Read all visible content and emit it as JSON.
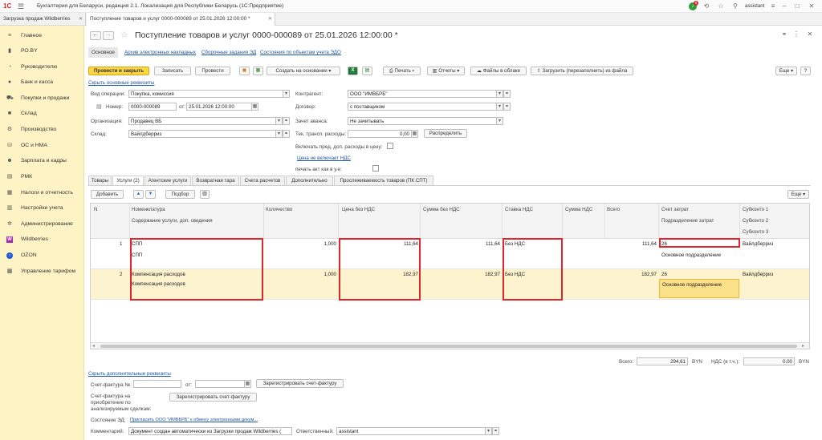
{
  "window": {
    "logo": "1С",
    "title": "Бухгалтерия для Беларуси, редакция 2.1. Локализация для Республики Беларусь   (1С:Предприятие)",
    "notification_count": "6",
    "user": "assistant"
  },
  "app_tabs": [
    {
      "label": "Загрузка продаж Wildberries"
    },
    {
      "label": "Поступление товаров и услуг 0000-000089 от 25.01.2026 12:00:00 *"
    }
  ],
  "sidebar": {
    "items": [
      {
        "label": "Главное",
        "icon": "menu-icon"
      },
      {
        "label": "РО.BY",
        "icon": "chart-icon"
      },
      {
        "label": "Руководителю",
        "icon": "chart-icon"
      },
      {
        "label": "Банк и касса",
        "icon": "coins-icon"
      },
      {
        "label": "Покупки и продажи",
        "icon": "cart-icon"
      },
      {
        "label": "Склад",
        "icon": "box-icon"
      },
      {
        "label": "Производство",
        "icon": "factory-icon"
      },
      {
        "label": "ОС и НМА",
        "icon": "asset-icon"
      },
      {
        "label": "Зарплата и кадры",
        "icon": "people-icon"
      },
      {
        "label": "РМК",
        "icon": "register-icon"
      },
      {
        "label": "Налоги и отчетность",
        "icon": "tax-icon"
      },
      {
        "label": "Настройки учета",
        "icon": "settings-icon"
      },
      {
        "label": "Администрирование",
        "icon": "gear-icon"
      },
      {
        "label": "Wildberries",
        "icon": "wb-icon",
        "badge": "W"
      },
      {
        "label": "OZON",
        "icon": "ozon-icon"
      },
      {
        "label": "Управление тарифом",
        "icon": "tariff-icon"
      }
    ]
  },
  "document": {
    "title": "Поступление товаров и услуг 0000-000089 от 25.01.2026 12:00:00 *",
    "subtabs": [
      "Основное",
      "Архив электронных накладных",
      "Сборочные задания ЭД",
      "Состояния по объектам учета ЭДО"
    ]
  },
  "toolbar": {
    "post_close": "Провести и закрыть",
    "save": "Записать",
    "post": "Провести",
    "create_based": "Создать на основании",
    "print": "Печать",
    "reports": "Отчеты",
    "cloud_files": "Файлы в облаке",
    "load_from_file": "Загрузить (перезаполнить) из файла",
    "more": "Еще",
    "help": "?"
  },
  "form": {
    "hide_main": "Скрыть основные реквизиты",
    "operation_label": "Вид операции:",
    "operation_value": "Покупка, комиссия",
    "number_label": "Номер:",
    "number_value": "0000-000089",
    "date_label": "от:",
    "date_value": "25.01.2026 12:00:00",
    "org_label": "Организация:",
    "org_value": "Продавец ВБ",
    "warehouse_label": "Склад:",
    "warehouse_value": "Вайлдберриз",
    "contractor_label": "Контрагент:",
    "contractor_value": "ООО \"ИМВБРБ\"",
    "contract_label": "Договор:",
    "contract_value": "с поставщиком",
    "advance_label": "Зачет аванса:",
    "advance_value": "Не зачитывать",
    "transport_label": "Тек. трансп. расходы:",
    "transport_value": "0,00",
    "distribute": "Распределить",
    "include_costs": "Включать пред. доп. расходы в цену:",
    "price_no_vat": "Цена не включает НДС",
    "print_act": "печать акт как в у.е:"
  },
  "doc_tabs": [
    "Товары",
    "Услуги (2)",
    "Агентские услуги",
    "Возвратная тара",
    "Счета расчетов",
    "Дополнительно",
    "Прослеживаемость товаров (ПК СПТ)"
  ],
  "grid_toolbar": {
    "add": "Добавить",
    "pick": "Подбор",
    "more": "Еще"
  },
  "grid": {
    "headers": {
      "n": "N",
      "item": "Номенклатура",
      "item_sub": "Содержание услуги, доп. сведения",
      "qty": "Количество",
      "price": "Цена без НДС",
      "sum": "Сумма без НДС",
      "vat_rate": "Ставка НДС",
      "vat_sum": "Сумма НДС",
      "total": "Всего",
      "account": "Счет затрат",
      "division": "Подразделение затрат",
      "sub1": "Субконто 1",
      "sub2": "Субконто 2",
      "sub3": "Субконто 3"
    },
    "rows": [
      {
        "n": "1",
        "item": "СПП",
        "content": "СПП",
        "qty": "1,000",
        "price": "111,64",
        "sum": "111,64",
        "vat_rate": "Без НДС",
        "total": "111,64",
        "account": "26",
        "division": "Основное подразделение",
        "sub1": "Вайлдберриз"
      },
      {
        "n": "2",
        "item": "Компенсация расходов",
        "content": "Компенсация расходов",
        "qty": "1,000",
        "price": "182,97",
        "sum": "182,97",
        "vat_rate": "Без НДС",
        "total": "182,97",
        "account": "26",
        "division": "Основное подразделение",
        "sub1": "Вайлдберриз"
      }
    ]
  },
  "totals": {
    "total_label": "Всего:",
    "total_value": "294,61",
    "currency": "BYN",
    "vat_label": "НДС (в т.ч.):",
    "vat_value": "0,00",
    "vat_currency": "BYN"
  },
  "extra": {
    "hide_extra": "Скрыть дополнительные реквизиты",
    "invoice_label": "Счет-фактура №:",
    "invoice_from": "от:",
    "register_invoice": "Зарегистрировать счет-фактуру",
    "invoice_purchase_label1": "Счет-фактура на",
    "invoice_purchase_label2": "приобретение по",
    "invoice_purchase_label3": "анализируемым сделкам:",
    "register_invoice2": "Зарегистрировать счет-фактуру",
    "ed_state_label": "Состояние ЭД:",
    "ed_state_link": "Пригласить ООО \"ИМВБРБ\" к обмену электронными докум...",
    "comment_label": "Комментарий:",
    "comment_value": "Документ создан автоматически из Загрузки продаж Wildberries (",
    "responsible_label": "Ответственный:",
    "responsible_value": "assistant"
  }
}
